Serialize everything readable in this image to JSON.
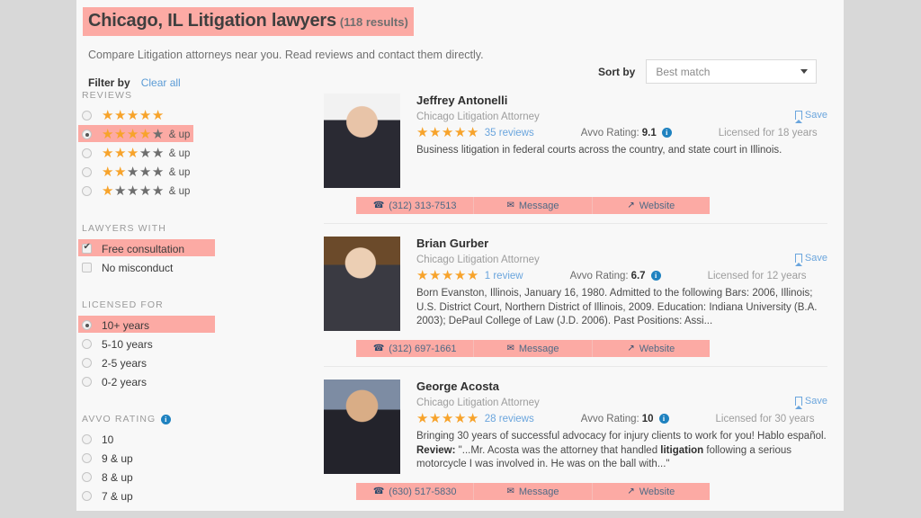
{
  "header": {
    "title": "Chicago, IL Litigation lawyers",
    "results_count": "(118 results)",
    "subtitle": "Compare Litigation attorneys near you. Read reviews and contact them directly.",
    "filter_by_label": "Filter by",
    "clear_all_label": "Clear all",
    "highlight_color": "#fcaaa4"
  },
  "sort": {
    "label": "Sort by",
    "selected": "Best match",
    "options": [
      "Best match"
    ]
  },
  "sidebar": {
    "sections": [
      {
        "heading": "REVIEWS",
        "type": "radio",
        "has_info": false,
        "options": [
          {
            "filled": 5,
            "total": 5,
            "suffix": "",
            "selected": false
          },
          {
            "filled": 4,
            "total": 5,
            "suffix": "& up",
            "selected": true
          },
          {
            "filled": 3,
            "total": 5,
            "suffix": "& up",
            "selected": false
          },
          {
            "filled": 2,
            "total": 5,
            "suffix": "& up",
            "selected": false
          },
          {
            "filled": 1,
            "total": 5,
            "suffix": "& up",
            "selected": false
          }
        ]
      },
      {
        "heading": "LAWYERS WITH",
        "type": "checkbox",
        "has_info": false,
        "options": [
          {
            "label": "Free consultation",
            "selected": true
          },
          {
            "label": "No misconduct",
            "selected": false
          }
        ]
      },
      {
        "heading": "LICENSED FOR",
        "type": "radio",
        "has_info": false,
        "options": [
          {
            "label": "10+ years",
            "selected": true
          },
          {
            "label": "5-10 years",
            "selected": false
          },
          {
            "label": "2-5 years",
            "selected": false
          },
          {
            "label": "0-2 years",
            "selected": false
          }
        ]
      },
      {
        "heading": "AVVO RATING",
        "type": "radio",
        "has_info": true,
        "options": [
          {
            "label": "10",
            "selected": false
          },
          {
            "label": "9 & up",
            "selected": false
          },
          {
            "label": "8 & up",
            "selected": false
          },
          {
            "label": "7 & up",
            "selected": false
          }
        ]
      }
    ]
  },
  "listings": [
    {
      "name": "Jeffrey Antonelli",
      "title": "Chicago Litigation Attorney",
      "stars": 5,
      "reviews_text": "35 reviews",
      "avvo_label": "Avvo Rating:",
      "avvo_value": "9.1",
      "licensed": "Licensed for 18 years",
      "save_label": "Save",
      "description": "Business litigation in federal courts across the country, and state court in Illinois.",
      "phone": "(312) 313-7513",
      "message_label": "Message",
      "website_label": "Website",
      "photo_tone": "#8c6552"
    },
    {
      "name": "Brian Gurber",
      "title": "Chicago Litigation Attorney",
      "stars": 5,
      "reviews_text": "1 review",
      "avvo_label": "Avvo Rating:",
      "avvo_value": "6.7",
      "licensed": "Licensed for 12 years",
      "save_label": "Save",
      "description": "Born Evanston, Illinois, January 16, 1980. Admitted to the following Bars: 2006, Illinois; U.S. District Court, Northern District of Illinois, 2009. Education: Indiana University (B.A. 2003); DePaul College of Law (J.D. 2006). Past Positions: Assi...",
      "phone": "(312) 697-1661",
      "message_label": "Message",
      "website_label": "Website",
      "photo_tone": "#6e4b31"
    },
    {
      "name": "George Acosta",
      "title": "Chicago Litigation Attorney",
      "stars": 5,
      "reviews_text": "28 reviews",
      "avvo_label": "Avvo Rating:",
      "avvo_value": "10",
      "licensed": "Licensed for 30 years",
      "save_label": "Save",
      "description": "Bringing 30 years of successful advocacy for injury clients to work for you! Hablo español.",
      "review_prefix": "Review:",
      "review_text_before": " \"...Mr. Acosta was the attorney that handled ",
      "review_highlight": "litigation",
      "review_text_after": " following a serious motorcycle I was involved in. He was on the ball with...\"",
      "phone": "(630) 517-5830",
      "message_label": "Message",
      "website_label": "Website",
      "photo_tone": "#5a6a80"
    }
  ],
  "icons": {
    "phone": "☎",
    "mail": "✉",
    "website": "↗",
    "bookmark": "bookmark-icon",
    "caret": "chevron-down-icon",
    "info": "i"
  },
  "colors": {
    "star_on": "#f7a32b",
    "star_off": "#6e6e6e",
    "link": "#6aa5dd",
    "highlight": "#fcaaa4",
    "info_badge": "#1f82c0"
  }
}
